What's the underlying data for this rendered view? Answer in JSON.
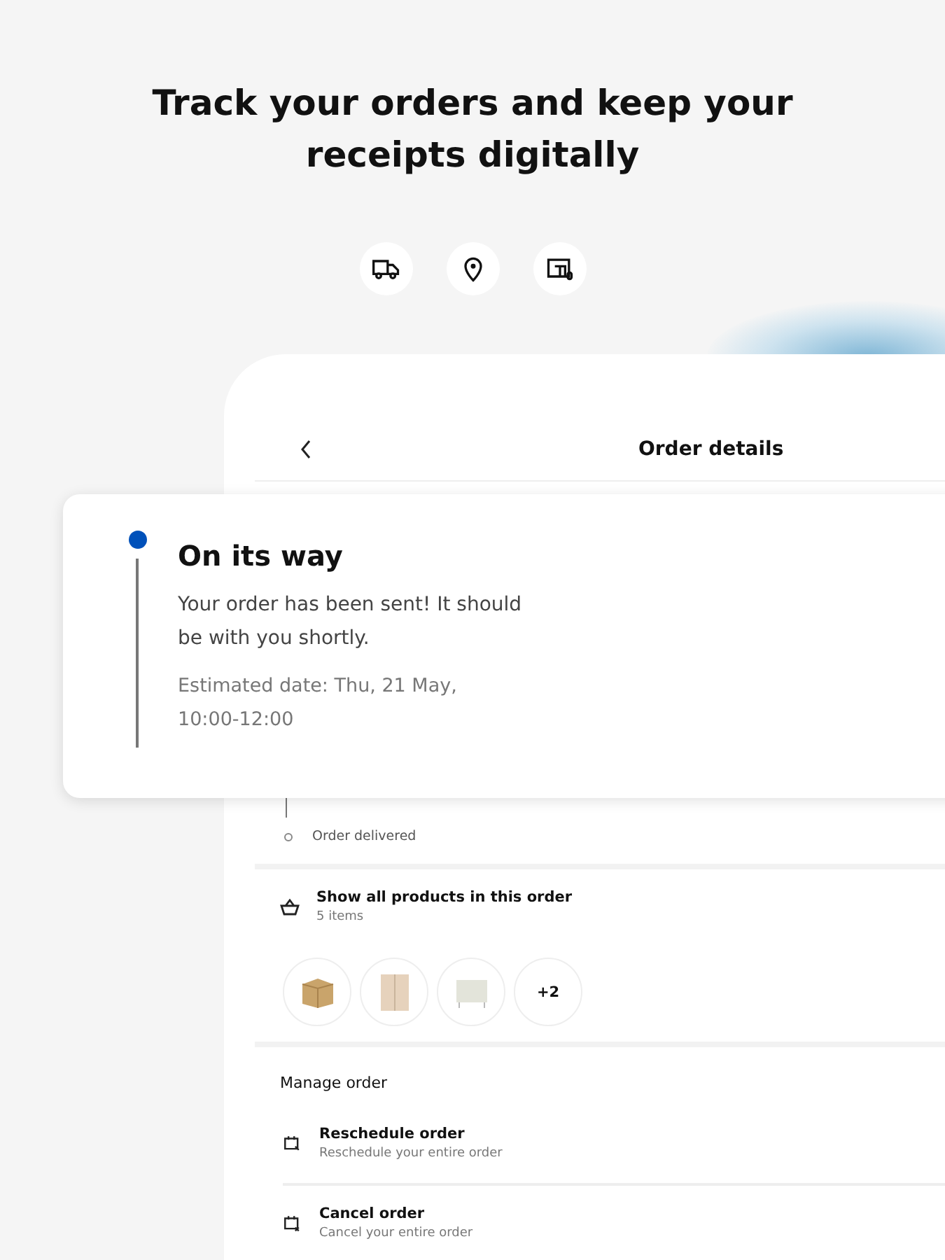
{
  "headline": "Track your orders and keep your receipts digitally",
  "feature_icons": [
    {
      "kind": "truck"
    },
    {
      "kind": "pin"
    },
    {
      "kind": "store"
    }
  ],
  "screen": {
    "title": "Order details"
  },
  "status_card": {
    "title": "On its way",
    "message": "Your order has been sent! It should be with you shortly.",
    "estimate": "Estimated date: Thu, 21 May, 10:00-12:00"
  },
  "timeline": [
    {
      "label": "Order delivered"
    }
  ],
  "products": {
    "title": "Show all products in this order",
    "count": "5 items",
    "thumbnails": [
      {
        "kind": "box"
      },
      {
        "kind": "cabinet"
      },
      {
        "kind": "dresser"
      }
    ],
    "more": "+2"
  },
  "manage": {
    "title": "Manage order",
    "actions": [
      {
        "kind": "reschedule",
        "title": "Reschedule order",
        "subtitle": "Reschedule your entire order"
      },
      {
        "kind": "cancel",
        "title": "Cancel order",
        "subtitle": "Cancel your entire order"
      }
    ]
  }
}
